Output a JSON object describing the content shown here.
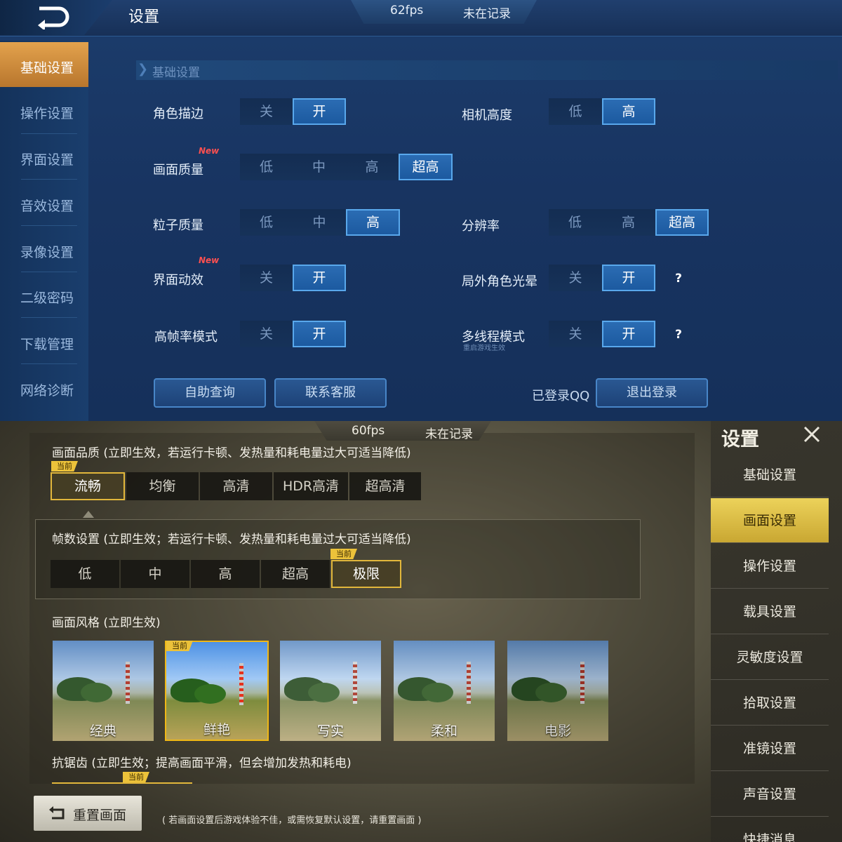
{
  "top": {
    "title": "设置",
    "fps": "62fps",
    "record": "未在记录",
    "sidebar": [
      "基础设置",
      "操作设置",
      "界面设置",
      "音效设置",
      "录像设置",
      "二级密码",
      "下载管理",
      "网络诊断"
    ],
    "section_title": "基础设置",
    "new_tag": "New",
    "settings": {
      "outline": {
        "label": "角色描边",
        "options": [
          "关",
          "开"
        ],
        "selected": "开"
      },
      "camera": {
        "label": "相机高度",
        "options": [
          "低",
          "高"
        ],
        "selected": "高"
      },
      "quality": {
        "label": "画面质量",
        "options": [
          "低",
          "中",
          "高",
          "超高"
        ],
        "selected": "超高"
      },
      "particle": {
        "label": "粒子质量",
        "options": [
          "低",
          "中",
          "高"
        ],
        "selected": "高"
      },
      "resolution": {
        "label": "分辨率",
        "options": [
          "低",
          "高",
          "超高"
        ],
        "selected": "超高"
      },
      "ui_anim": {
        "label": "界面动效",
        "options": [
          "关",
          "开"
        ],
        "selected": "开"
      },
      "halo": {
        "label": "局外角色光晕",
        "options": [
          "关",
          "开"
        ],
        "selected": "开"
      },
      "high_fps": {
        "label": "高帧率模式",
        "options": [
          "关",
          "开"
        ],
        "selected": "开"
      },
      "multithread": {
        "label": "多线程模式",
        "hint": "重启游戏生效",
        "options": [
          "关",
          "开"
        ],
        "selected": "开"
      }
    },
    "help_mark": "?",
    "buttons": {
      "self_query": "自助查询",
      "contact": "联系客服",
      "logged_qq": "已登录QQ",
      "logout": "退出登录"
    }
  },
  "bottom": {
    "fps": "60fps",
    "record": "未在记录",
    "current_tag": "当前",
    "quality_heading": "画面品质 (立即生效，若运行卡顿、发热量和耗电量过大可适当降低)",
    "quality_options": [
      "流畅",
      "均衡",
      "高清",
      "HDR高清",
      "超高清"
    ],
    "quality_selected": "流畅",
    "fps_heading": "帧数设置 (立即生效；若运行卡顿、发热量和耗电量过大可适当降低)",
    "fps_options": [
      "低",
      "中",
      "高",
      "超高",
      "极限"
    ],
    "fps_selected": "极限",
    "style_heading": "画面风格 (立即生效)",
    "styles": [
      "经典",
      "鲜艳",
      "写实",
      "柔和",
      "电影"
    ],
    "style_selected": "鲜艳",
    "aa_heading": "抗锯齿 (立即生效；提高画面平滑，但会增加发热和耗电)",
    "reset_label": "重置画面",
    "reset_hint": "( 若画面设置后游戏体验不佳，或需恢复默认设置，请重置画面 )",
    "panel_title": "设置",
    "menu": [
      "基础设置",
      "画面设置",
      "操作设置",
      "载具设置",
      "灵敏度设置",
      "拾取设置",
      "准镜设置",
      "声音设置",
      "快捷消息"
    ],
    "menu_selected": "画面设置"
  },
  "colors": {
    "top_accent": "#2b6cb3",
    "top_active_tab": "#e3a24d",
    "bottom_accent": "#e2b73b",
    "new_tag": "#ff5050"
  }
}
